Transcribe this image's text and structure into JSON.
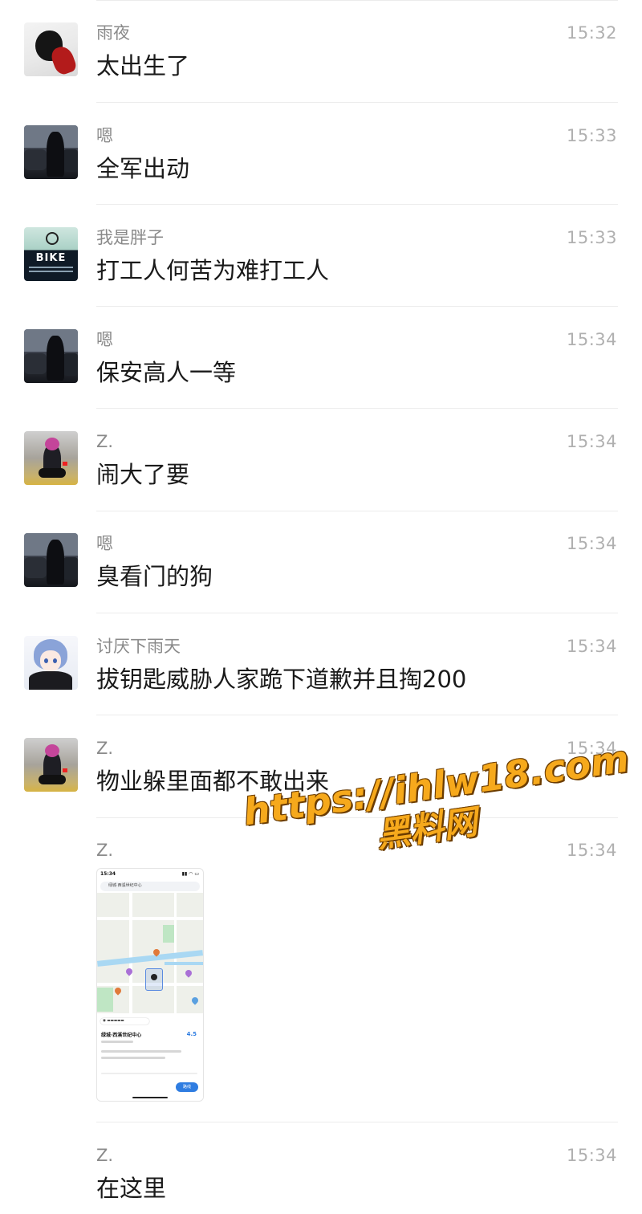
{
  "messages": [
    {
      "name": "雨夜",
      "time": "15:32",
      "text": "太出生了",
      "avatar": "red-figure-avatar"
    },
    {
      "name": "嗯",
      "time": "15:33",
      "text": "全军出动",
      "avatar": "dark-street-avatar"
    },
    {
      "name": "我是胖子",
      "time": "15:33",
      "text": "打工人何苦为难打工人",
      "avatar": "bike-avatar",
      "avatar_text": "BIKE"
    },
    {
      "name": "嗯",
      "time": "15:34",
      "text": "保安高人一等",
      "avatar": "dark-street-avatar"
    },
    {
      "name": "Z.",
      "time": "15:34",
      "text": "闹大了要",
      "avatar": "motorcycle-rider-avatar"
    },
    {
      "name": "嗯",
      "time": "15:34",
      "text": "臭看门的狗",
      "avatar": "dark-street-avatar"
    },
    {
      "name": "讨厌下雨天",
      "time": "15:34",
      "text": "拔钥匙威胁人家跪下道歉并且掏200",
      "avatar": "anime-girl-avatar"
    },
    {
      "name": "Z.",
      "time": "15:34",
      "text": "物业躲里面都不敢出来",
      "avatar": "motorcycle-rider-avatar"
    },
    {
      "name": "Z.",
      "time": "15:34",
      "image": "map-screenshot",
      "avatar": null,
      "image_content": {
        "status_time": "15:34",
        "search": "绿城·西溪世纪中心",
        "place_title": "绿城·西溪世纪中心",
        "rating": "4.5",
        "nav_button": "路线"
      }
    },
    {
      "name": "Z.",
      "time": "15:34",
      "text": "在这里",
      "avatar": null
    }
  ],
  "watermark": {
    "url": "https://ihlw18.com",
    "name": "黑料网"
  },
  "colors": {
    "name": "#8a8a8a",
    "time": "#b0b0b0",
    "text": "#1a1a1a",
    "divider": "#ececec",
    "watermark": "#f6a91c"
  }
}
